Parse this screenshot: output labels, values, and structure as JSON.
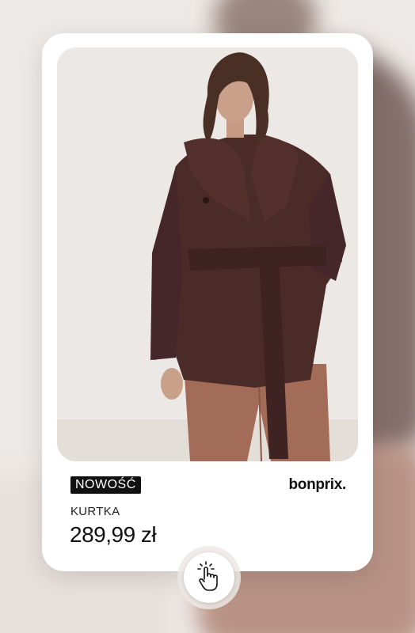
{
  "product": {
    "badge": "NOWOŚĆ",
    "brand": "bonprix.",
    "category": "KURTKA",
    "price": "289,99 zł"
  },
  "icons": {
    "tap": "hand-pointer-tap-icon"
  },
  "colors": {
    "badge_bg": "#111111",
    "badge_text": "#ffffff",
    "coat": "#4a2a27",
    "pants": "#a26b57"
  }
}
